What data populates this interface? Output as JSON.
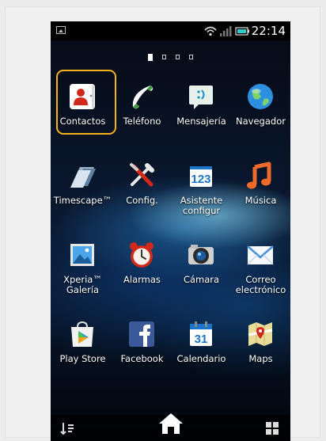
{
  "status_bar": {
    "time": "22:14"
  },
  "page_indicator": {
    "count": 4,
    "active": 0
  },
  "apps": [
    {
      "label": "Contactos",
      "icon": "contacts-icon",
      "selected": true
    },
    {
      "label": "Teléfono",
      "icon": "phone-icon"
    },
    {
      "label": "Mensajería",
      "icon": "messaging-icon"
    },
    {
      "label": "Navegador",
      "icon": "browser-globe-icon"
    },
    {
      "label": "Timescape™",
      "icon": "timescape-icon"
    },
    {
      "label": "Config.",
      "icon": "settings-tools-icon"
    },
    {
      "label": "Asistente configur",
      "icon": "setup-wizard-icon"
    },
    {
      "label": "Música",
      "icon": "music-note-icon"
    },
    {
      "label": "Xperia™ Galería",
      "icon": "gallery-icon"
    },
    {
      "label": "Alarmas",
      "icon": "alarm-clock-icon"
    },
    {
      "label": "Cámara",
      "icon": "camera-icon"
    },
    {
      "label": "Correo electrónico",
      "icon": "email-envelope-icon"
    },
    {
      "label": "Play Store",
      "icon": "play-store-icon"
    },
    {
      "label": "Facebook",
      "icon": "facebook-icon"
    },
    {
      "label": "Calendario",
      "icon": "calendar-icon"
    },
    {
      "label": "Maps",
      "icon": "maps-icon"
    }
  ],
  "calendar_day": "31",
  "setup_number": "123",
  "bottom_bar": {
    "left": "sort-icon",
    "center": "home-icon",
    "right": "app-grid-icon"
  },
  "colors": {
    "selection": "#f5b21a",
    "accent_blue": "#2b8fd6"
  }
}
